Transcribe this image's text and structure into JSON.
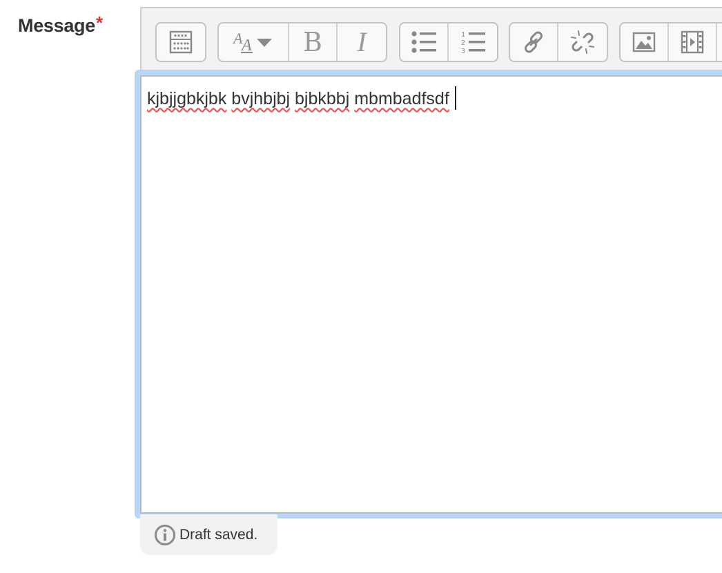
{
  "form": {
    "label": "Message",
    "required_marker": "*"
  },
  "toolbar": {
    "groups": [
      [
        {
          "name": "toolbar-toggle",
          "icon": "show-more-icon"
        }
      ],
      [
        {
          "name": "paragraph-styles",
          "icon": "font-size-dropdown-icon"
        },
        {
          "name": "bold",
          "icon": "bold-icon"
        },
        {
          "name": "italic",
          "icon": "italic-icon"
        }
      ],
      [
        {
          "name": "unordered-list",
          "icon": "bullet-list-icon"
        },
        {
          "name": "ordered-list",
          "icon": "numbered-list-icon"
        }
      ],
      [
        {
          "name": "link",
          "icon": "link-icon"
        },
        {
          "name": "unlink",
          "icon": "unlink-icon"
        }
      ],
      [
        {
          "name": "insert-image",
          "icon": "image-icon"
        },
        {
          "name": "insert-media",
          "icon": "film-icon"
        }
      ]
    ],
    "bold_glyph": "B",
    "italic_glyph": "I"
  },
  "editor": {
    "words": [
      "kjbjjgbkjbk",
      "bvjhbjbj",
      "bjbkbbj",
      "mbmbadfsdf"
    ]
  },
  "status": {
    "text": "Draft saved.",
    "icon": "info-icon"
  },
  "colors": {
    "required": "#e0302f",
    "focus_ring": "#b9d7f4",
    "spellcheck": "#e74a4a"
  }
}
